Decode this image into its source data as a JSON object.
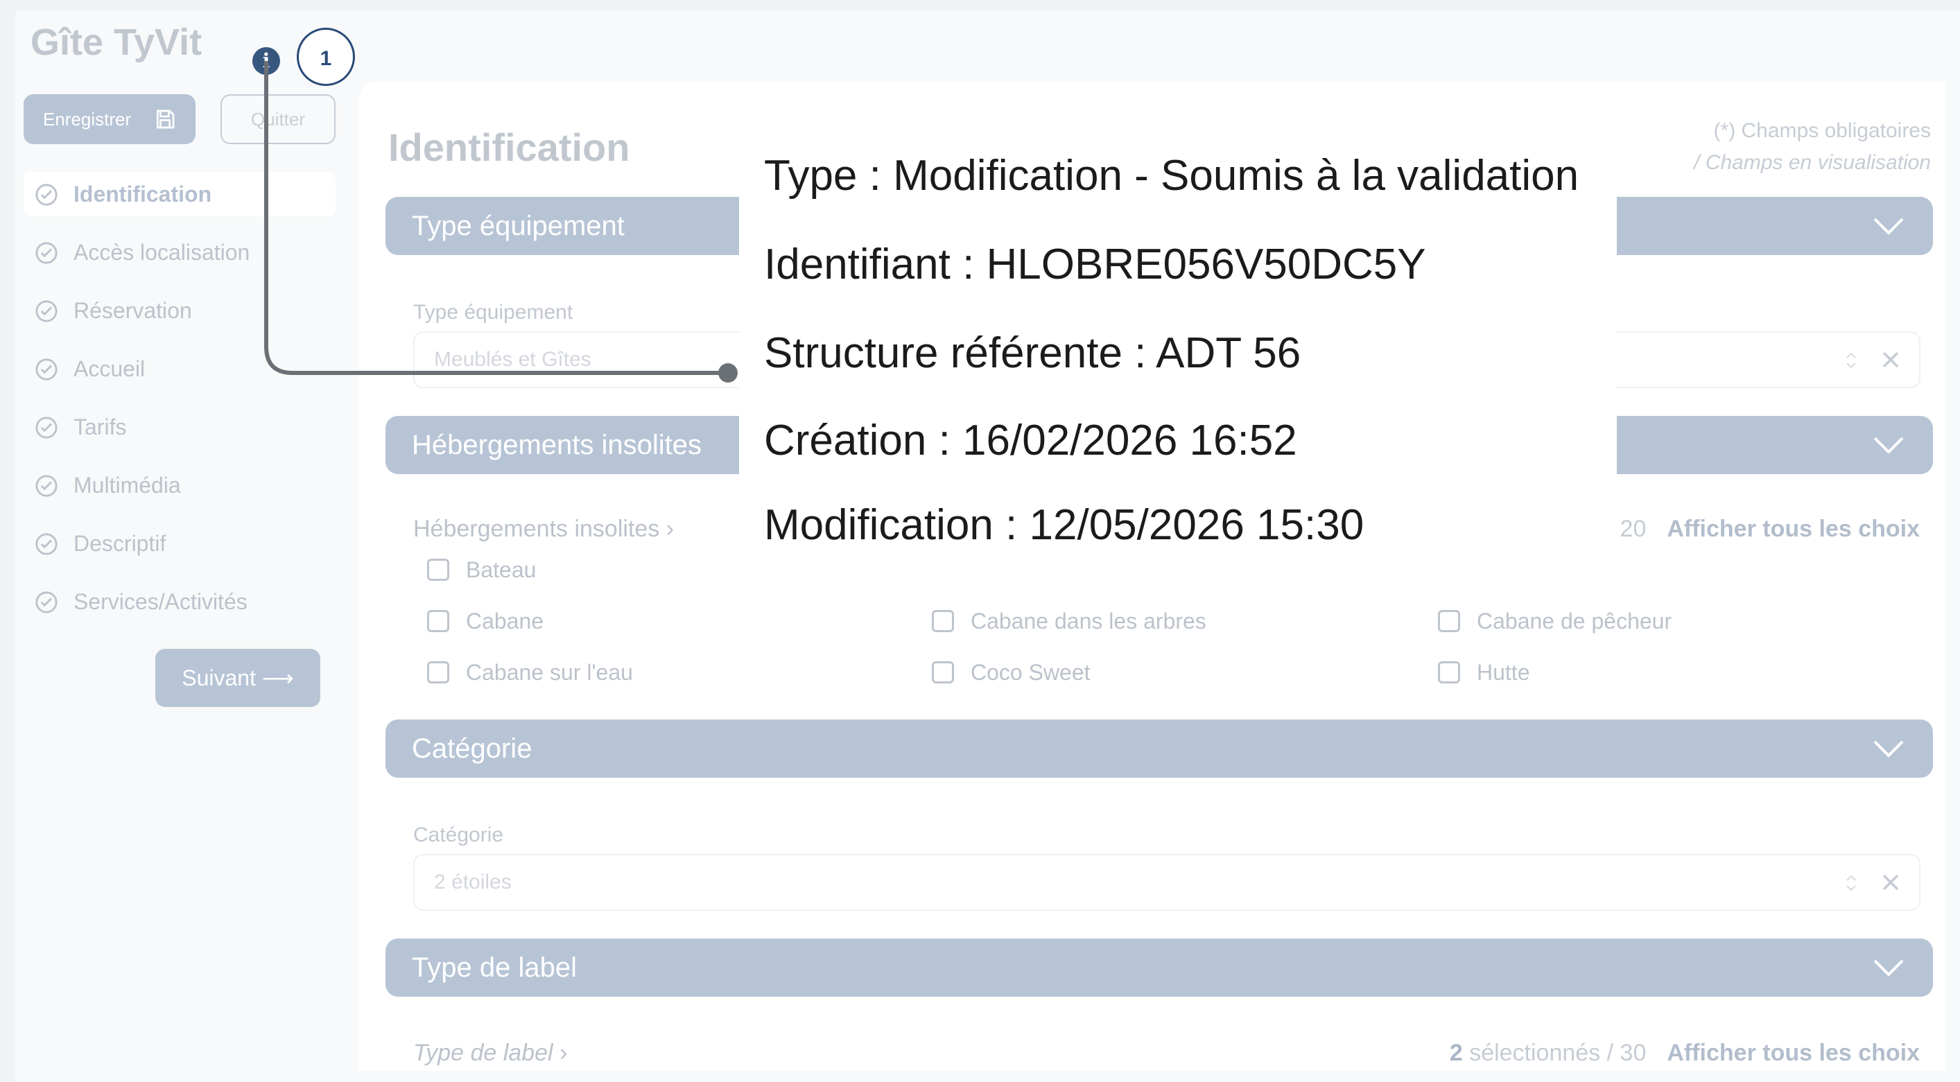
{
  "header": {
    "app_title": "Gîte TyVit",
    "step_number": "1",
    "info_icon_glyph": "i"
  },
  "toolbar": {
    "save_label": "Enregistrer",
    "quit_label": "Quitter"
  },
  "sidebar": {
    "items": [
      {
        "label": "Identification",
        "active": true,
        "icon": "check-circle-icon"
      },
      {
        "label": "Accès localisation",
        "active": false,
        "icon": "check-circle-icon"
      },
      {
        "label": "Réservation",
        "active": false,
        "icon": "check-circle-icon"
      },
      {
        "label": "Accueil",
        "active": false,
        "icon": "check-circle-icon"
      },
      {
        "label": "Tarifs",
        "active": false,
        "icon": "check-circle-icon"
      },
      {
        "label": "Multimédia",
        "active": false,
        "icon": "check-circle-icon"
      },
      {
        "label": "Descriptif",
        "active": false,
        "icon": "check-circle-icon"
      },
      {
        "label": "Services/Activités",
        "active": false,
        "icon": "check-circle-icon"
      }
    ],
    "next_label": "Suivant",
    "next_arrow": "⟶"
  },
  "main": {
    "title": "Identification",
    "legend_required": "(*) Champs obligatoires",
    "legend_view": "/ Champs en visualisation",
    "sections": {
      "type_equipement": {
        "header": "Type équipement",
        "field_label": "Type équipement",
        "field_value": "Meublés et Gîtes"
      },
      "hebergements": {
        "header": "Hébergements insolites",
        "sub_label": "Hébergements insolites",
        "sub_chevron": "›",
        "count_text": "20",
        "show_all": "Afficher tous les choix",
        "checkboxes": [
          "Bateau",
          "Cabane",
          "Cabane dans les arbres",
          "Cabane de pêcheur",
          "Cabane sur l'eau",
          "Coco Sweet",
          "Hutte"
        ]
      },
      "categorie": {
        "header": "Catégorie",
        "field_label": "Catégorie",
        "field_value": "2 étoiles"
      },
      "type_label": {
        "header": "Type de label",
        "sub_label": "Type de label",
        "sub_chevron": "›",
        "selected_count": "2",
        "selected_text": "sélectionnés / 30",
        "show_all": "Afficher tous les choix"
      }
    }
  },
  "tooltip": {
    "type": "Type : Modification - Soumis à la validation",
    "identifiant": "Identifiant : HLOBRE056V50DC5Y",
    "structure": "Structure référente : ADT 56",
    "creation": "Création : 16/02/2026 16:52",
    "modification": "Modification : 12/05/2026 15:30"
  },
  "colors": {
    "accent": "#b7c4d5",
    "badge_border": "#2a4a78",
    "info_icon": "#38577f",
    "connector": "#6b6f76"
  }
}
